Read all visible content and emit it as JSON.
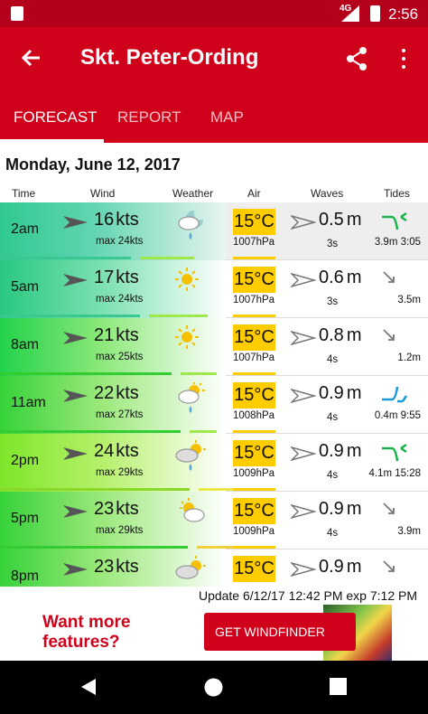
{
  "status_bar": {
    "time": "2:56",
    "network": "4G"
  },
  "app_bar": {
    "title": "Skt. Peter-Ording"
  },
  "tabs": [
    {
      "label": "FORECAST"
    },
    {
      "label": "REPORT"
    },
    {
      "label": "MAP"
    }
  ],
  "date": "Monday, June 12, 2017",
  "columns": {
    "time": "Time",
    "wind": "Wind",
    "weather": "Weather",
    "air": "Air",
    "waves": "Waves",
    "tides": "Tides"
  },
  "rows": [
    {
      "time": "2am",
      "wind": "16",
      "wind_unit": "kts",
      "max": "max 24kts",
      "weather": "night-rain",
      "air": "15°C",
      "pressure": "1007hPa",
      "wave": "0.5",
      "wave_unit": "m",
      "period": "3s",
      "tide_icon": "tide-high-icon",
      "tide": "3.9m 3:05"
    },
    {
      "time": "5am",
      "wind": "17",
      "wind_unit": "kts",
      "max": "max 24kts",
      "weather": "sun",
      "air": "15°C",
      "pressure": "1007hPa",
      "wave": "0.6",
      "wave_unit": "m",
      "period": "3s",
      "tide_icon": "tide-falling-icon",
      "tide": "3.5m"
    },
    {
      "time": "8am",
      "wind": "21",
      "wind_unit": "kts",
      "max": "max 25kts",
      "weather": "sun",
      "air": "15°C",
      "pressure": "1007hPa",
      "wave": "0.8",
      "wave_unit": "m",
      "period": "4s",
      "tide_icon": "tide-falling-icon",
      "tide": "1.2m"
    },
    {
      "time": "11am",
      "wind": "22",
      "wind_unit": "kts",
      "max": "max 27kts",
      "weather": "sun-cloud-rain",
      "air": "15°C",
      "pressure": "1008hPa",
      "wave": "0.9",
      "wave_unit": "m",
      "period": "4s",
      "tide_icon": "tide-low-icon",
      "tide": "0.4m 9:55"
    },
    {
      "time": "2pm",
      "wind": "24",
      "wind_unit": "kts",
      "max": "max 29kts",
      "weather": "cloud-sun-rain",
      "air": "15°C",
      "pressure": "1009hPa",
      "wave": "0.9",
      "wave_unit": "m",
      "period": "4s",
      "tide_icon": "tide-high-icon",
      "tide": "4.1m 15:28"
    },
    {
      "time": "5pm",
      "wind": "23",
      "wind_unit": "kts",
      "max": "max 29kts",
      "weather": "sun-cloud",
      "air": "15°C",
      "pressure": "1009hPa",
      "wave": "0.9",
      "wave_unit": "m",
      "period": "4s",
      "tide_icon": "tide-falling-icon",
      "tide": "3.9m"
    },
    {
      "time": "8pm",
      "wind": "23",
      "wind_unit": "kts",
      "max": "",
      "weather": "cloud-sun",
      "air": "15°C",
      "pressure": "",
      "wave": "0.9",
      "wave_unit": "m",
      "period": "",
      "tide_icon": "tide-falling-icon",
      "tide": ""
    }
  ],
  "update": "Update 6/12/17 12:42 PM exp 7:12 PM",
  "ad": {
    "text_line1": "Want more",
    "text_line2": "features?",
    "button": "GET WINDFINDER PRO"
  },
  "colors": {
    "brand": "#d0021b",
    "status": "#b5001c",
    "temp_bg": "#ffcc00"
  }
}
